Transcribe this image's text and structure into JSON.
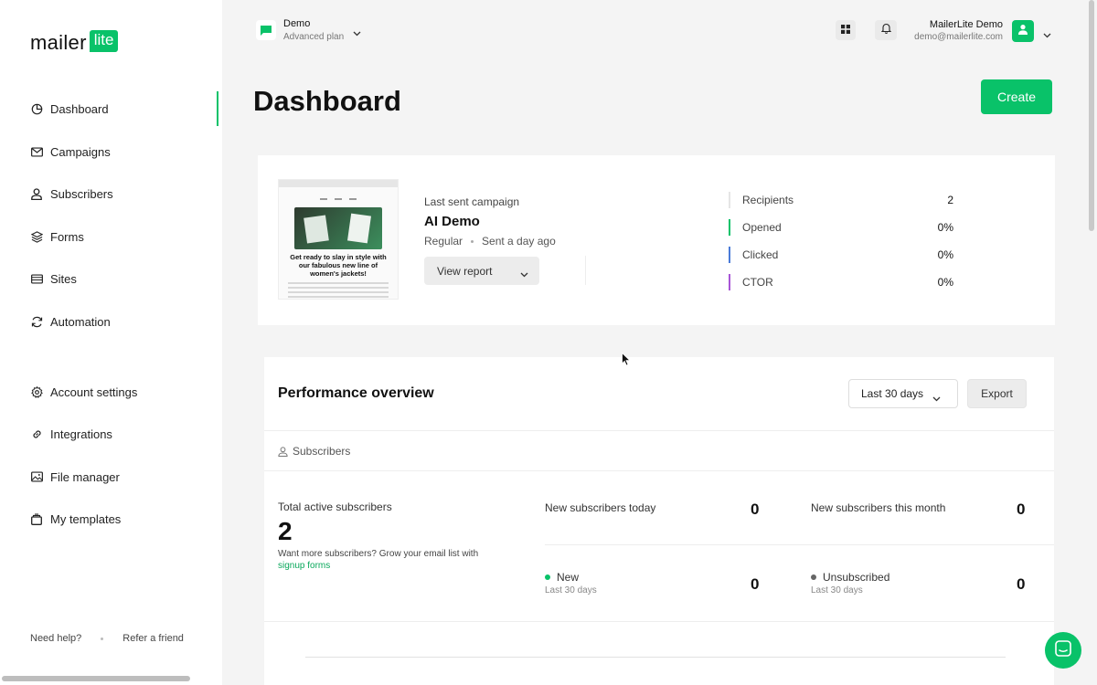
{
  "app": {
    "logo_text": "mailer",
    "logo_badge": "lite"
  },
  "sidebar": {
    "items": [
      {
        "label": "Dashboard",
        "icon": "dashboard-icon"
      },
      {
        "label": "Campaigns",
        "icon": "mail-icon"
      },
      {
        "label": "Subscribers",
        "icon": "user-icon"
      },
      {
        "label": "Forms",
        "icon": "layers-icon"
      },
      {
        "label": "Sites",
        "icon": "browser-icon"
      },
      {
        "label": "Automation",
        "icon": "refresh-icon"
      },
      {
        "label": "Account settings",
        "icon": "gear-icon"
      },
      {
        "label": "Integrations",
        "icon": "link-icon"
      },
      {
        "label": "File manager",
        "icon": "image-icon"
      },
      {
        "label": "My templates",
        "icon": "template-icon"
      }
    ],
    "footer": {
      "help": "Need help?",
      "refer": "Refer a friend"
    }
  },
  "topbar": {
    "workspace_name": "Demo",
    "workspace_plan": "Advanced plan",
    "user_name": "MailerLite Demo",
    "user_email": "demo@mailerlite.com"
  },
  "page": {
    "title": "Dashboard",
    "create_label": "Create"
  },
  "campaign": {
    "section_label": "Last sent campaign",
    "name": "AI Demo",
    "type": "Regular",
    "sent": "Sent a day ago",
    "view_report_label": "View report",
    "thumbnail_headline": "Get ready to slay in style with our fabulous new line of women's jackets!",
    "stats": [
      {
        "label": "Recipients",
        "value": "2",
        "color": "#ffffff"
      },
      {
        "label": "Opened",
        "value": "0%",
        "color": "#09c269"
      },
      {
        "label": "Clicked",
        "value": "0%",
        "color": "#4a7bd8"
      },
      {
        "label": "CTOR",
        "value": "0%",
        "color": "#a855d6"
      }
    ]
  },
  "performance": {
    "title": "Performance overview",
    "range_label": "Last 30 days",
    "export_label": "Export",
    "section_label": "Subscribers",
    "total_label": "Total active subscribers",
    "total_value": "2",
    "hint_text": "Want more subscribers? Grow your email list with",
    "hint_link": "signup forms",
    "new_today_label": "New subscribers today",
    "new_today_value": "0",
    "new_month_label": "New subscribers this month",
    "new_month_value": "0",
    "new_label": "New",
    "new_sub": "Last 30 days",
    "new_value": "0",
    "unsub_label": "Unsubscribed",
    "unsub_sub": "Last 30 days",
    "unsub_value": "0"
  },
  "colors": {
    "brand_green": "#09c269",
    "clicked_blue": "#4a7bd8",
    "ctor_purple": "#a855d6"
  }
}
